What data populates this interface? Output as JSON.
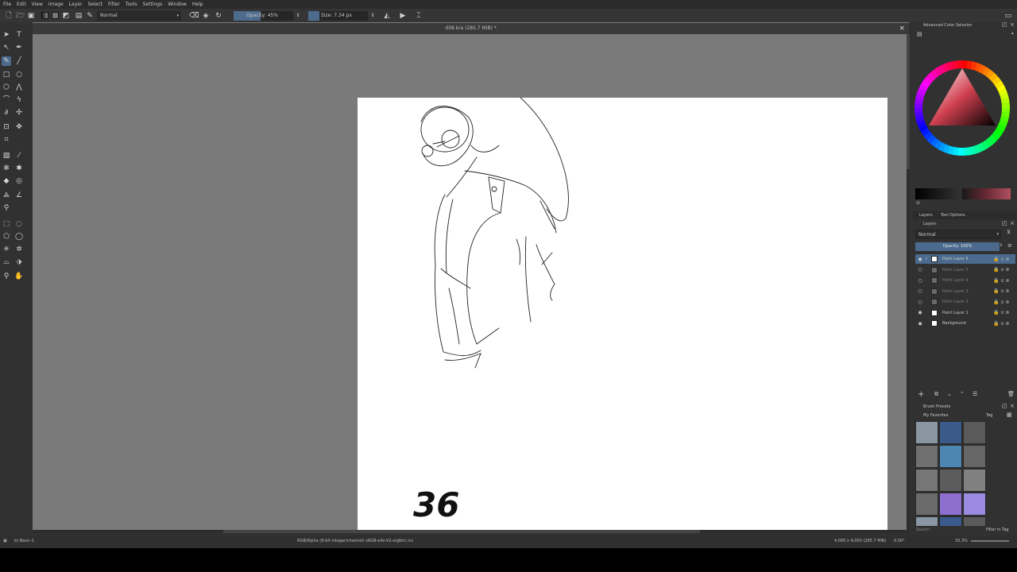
{
  "menu": [
    "File",
    "Edit",
    "View",
    "Image",
    "Layer",
    "Select",
    "Filter",
    "Tools",
    "Settings",
    "Window",
    "Help"
  ],
  "toolbar": {
    "blend_mode": "Normal",
    "opacity_label": "Opacity: 45%",
    "opacity_fraction": 0.45,
    "size_label": "Size: 7.34 px"
  },
  "document": {
    "tab_title": "d38.kra (285.7 MiB) *"
  },
  "canvas": {
    "sketch_text": "36"
  },
  "status": {
    "brush": "b) Basic-1",
    "color_info": "RGB/Alpha (8-bit integer/channel)  sRGB-elle-V2-srgbtrc.icc",
    "dims": "4,000 x 4,000 (285.7 MiB)",
    "rotation": "0.00°",
    "zoom": "33.3%"
  },
  "dock": {
    "color_selector_title": "Advanced Color Selector",
    "tabs": [
      "Layers",
      "Tool Options"
    ],
    "layers_title": "Layers",
    "blend_mode": "Normal",
    "opacity_label": "Opacity: 100%",
    "layers": [
      {
        "name": "Paint Layer 6",
        "visible": true,
        "selected": true
      },
      {
        "name": "Paint Layer 5",
        "visible": false,
        "selected": false
      },
      {
        "name": "Paint Layer 4",
        "visible": false,
        "selected": false
      },
      {
        "name": "Paint Layer 3",
        "visible": false,
        "selected": false
      },
      {
        "name": "Paint Layer 2",
        "visible": false,
        "selected": false
      },
      {
        "name": "Paint Layer 1",
        "visible": true,
        "selected": false
      },
      {
        "name": "Background",
        "visible": true,
        "selected": false
      }
    ],
    "brush_presets_title": "Brush Presets",
    "brush_tag": "My Favorites",
    "brush_tag_label": "Tag",
    "search_placeholder": "Search",
    "filter_in_tag": "Filter in Tag"
  },
  "colors": {
    "accent": "#4b6a8e",
    "canvas_bg": "#7a7a7a",
    "panel_bg": "#313131"
  }
}
